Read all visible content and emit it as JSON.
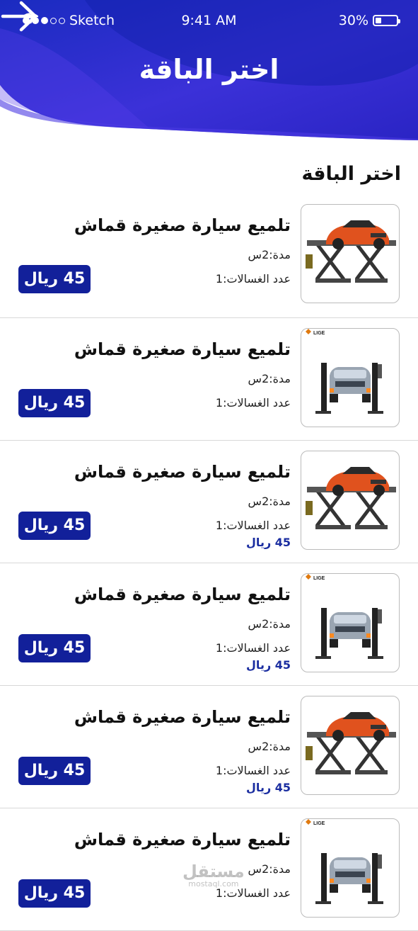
{
  "status_bar": {
    "carrier": "Sketch",
    "time": "9:41 AM",
    "battery": "30%",
    "battery_level": 0.3
  },
  "header": {
    "title": "اختر الباقة",
    "back_icon": "arrow-right-icon"
  },
  "section": {
    "title": "اختر الباقة"
  },
  "colors": {
    "primary": "#12209a",
    "gradient_start": "#1528b8",
    "gradient_end": "#5a36e6"
  },
  "packages": [
    {
      "title": "تلميع سيارة صغيرة قماش",
      "duration": "مدة:2س",
      "washers": "عدد الغسالات:1",
      "price": "45 ريال",
      "price_note": "",
      "image": "orange-car-scissor-lift"
    },
    {
      "title": "تلميع سيارة صغيرة قماش",
      "duration": "مدة:2س",
      "washers": "عدد الغسالات:1",
      "price": "45 ريال",
      "price_note": "",
      "image": "silver-suv-two-post-lift"
    },
    {
      "title": "تلميع سيارة صغيرة قماش",
      "duration": "مدة:2س",
      "washers": "عدد الغسالات:1",
      "price": "45 ريال",
      "price_note": "45 ريال",
      "image": "orange-car-scissor-lift"
    },
    {
      "title": "تلميع سيارة صغيرة قماش",
      "duration": "مدة:2س",
      "washers": "عدد الغسالات:1",
      "price": "45 ريال",
      "price_note": "45 ريال",
      "image": "silver-suv-two-post-lift"
    },
    {
      "title": "تلميع سيارة صغيرة قماش",
      "duration": "مدة:2س",
      "washers": "عدد الغسالات:1",
      "price": "45 ريال",
      "price_note": "45 ريال",
      "image": "orange-car-scissor-lift"
    },
    {
      "title": "تلميع سيارة صغيرة قماش",
      "duration": "مدة:2س",
      "washers": "عدد الغسالات:1",
      "price": "45 ريال",
      "price_note": "",
      "image": "silver-suv-two-post-lift"
    }
  ],
  "lift_brand": "LIGE",
  "watermark": {
    "main": "مستقل",
    "sub": "mostaql.com"
  }
}
